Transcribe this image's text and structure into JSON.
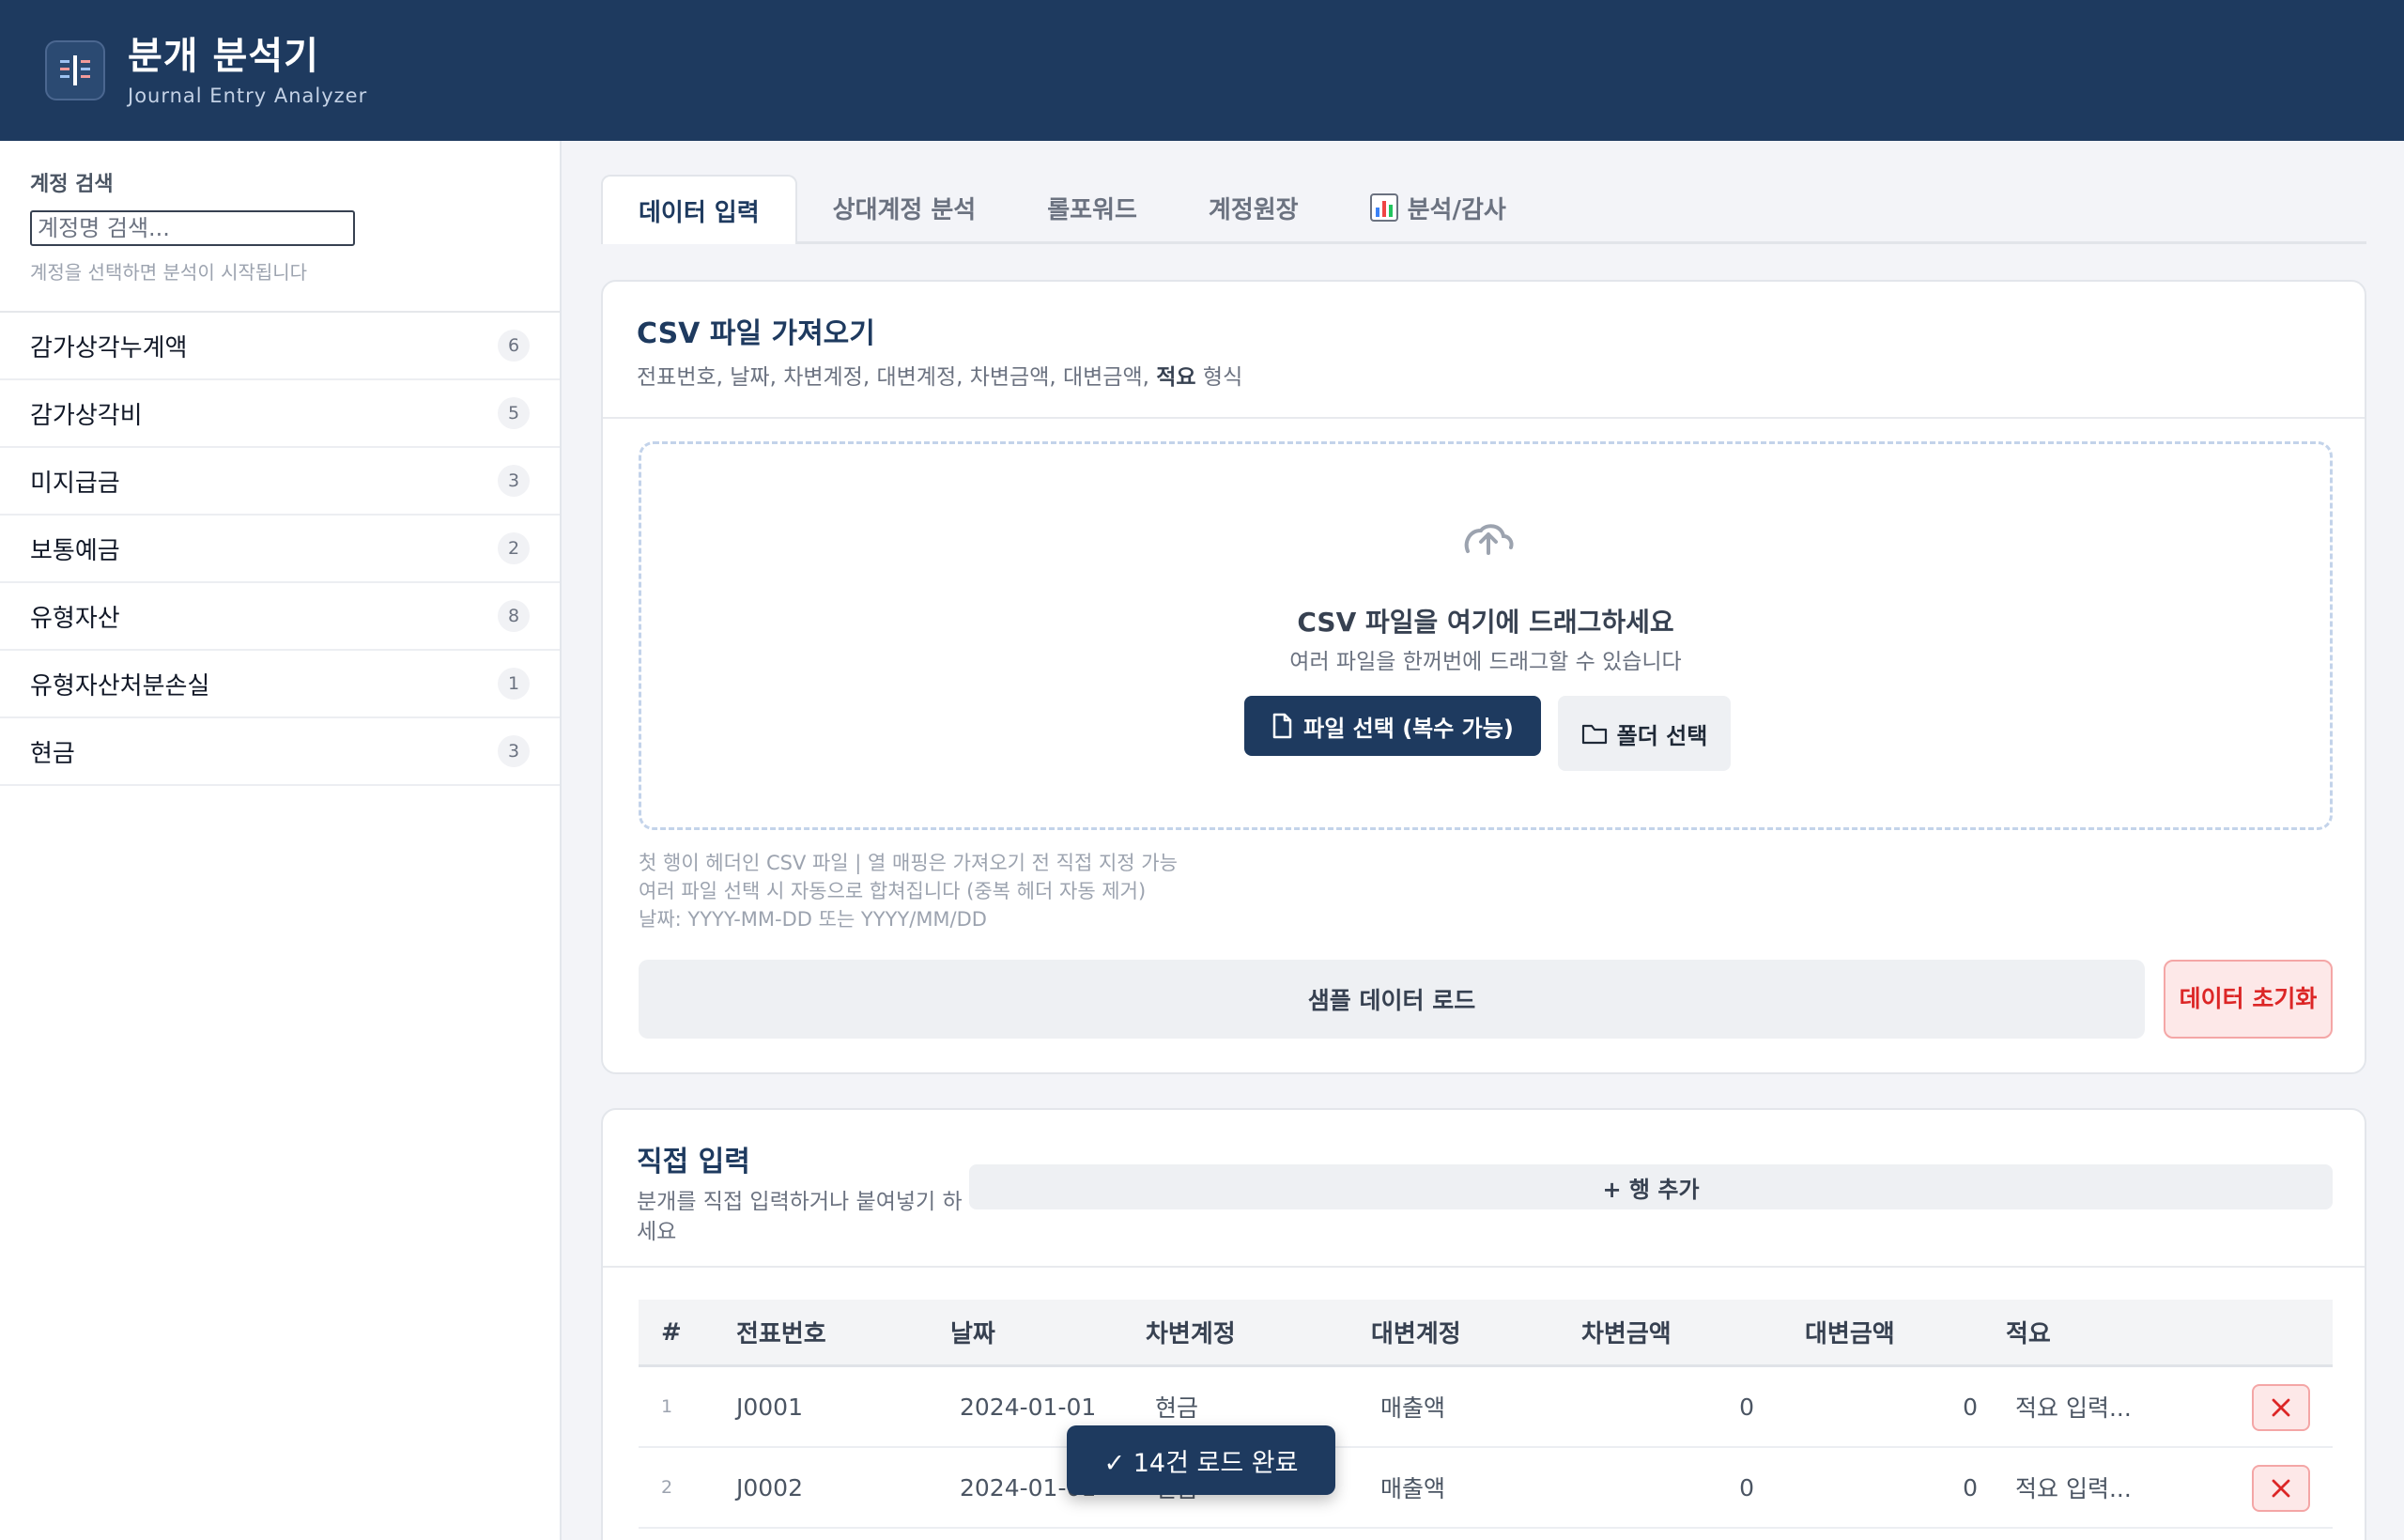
{
  "app": {
    "title": "분개 분석기",
    "subtitle": "Journal Entry Analyzer"
  },
  "sidebar": {
    "search_heading": "계정 검색",
    "search_placeholder": "계정명 검색...",
    "search_hint": "계정을 선택하면 분석이 시작됩니다",
    "accounts": [
      {
        "name": "감가상각누계액",
        "count": "6"
      },
      {
        "name": "감가상각비",
        "count": "5"
      },
      {
        "name": "미지급금",
        "count": "3"
      },
      {
        "name": "보통예금",
        "count": "2"
      },
      {
        "name": "유형자산",
        "count": "8"
      },
      {
        "name": "유형자산처분손실",
        "count": "1"
      },
      {
        "name": "현금",
        "count": "3"
      }
    ]
  },
  "tabs": [
    {
      "label": "데이터 입력"
    },
    {
      "label": "상대계정 분석"
    },
    {
      "label": "롤포워드"
    },
    {
      "label": "계정원장"
    },
    {
      "label": "분석/감사"
    }
  ],
  "csv_card": {
    "title": "CSV 파일 가져오기",
    "desc_prefix": "전표번호, 날짜, 차변계정, 대변계정, 차변금액, 대변금액, ",
    "desc_bold": "적요",
    "desc_suffix": " 형식",
    "drop_title": "CSV 파일을 여기에 드래그하세요",
    "drop_sub": "여러 파일을 한꺼번에 드래그할 수 있습니다",
    "file_button": "파일 선택 (복수 가능)",
    "folder_button": "폴더 선택",
    "notes": [
      "첫 행이 헤더인 CSV 파일 | 열 매핑은 가져오기 전 직접 지정 가능",
      "여러 파일 선택 시 자동으로 합쳐집니다 (중복 헤더 자동 제거)",
      "날짜: YYYY-MM-DD 또는 YYYY/MM/DD"
    ],
    "sample_button": "샘플 데이터 로드",
    "reset_button": "데이터 초기화"
  },
  "manual_card": {
    "title": "직접 입력",
    "desc": "분개를 직접 입력하거나 붙여넣기 하세요",
    "add_row_button": "+ 행 추가",
    "columns": [
      "#",
      "전표번호",
      "날짜",
      "차변계정",
      "대변계정",
      "차변금액",
      "대변금액",
      "적요"
    ],
    "rows": [
      {
        "no": "1",
        "voucher": "J0001",
        "date": "2024-01-01",
        "debit": "현금",
        "credit": "매출액",
        "debit_amt": "0",
        "credit_amt": "0",
        "memo_placeholder": "적요 입력..."
      },
      {
        "no": "2",
        "voucher": "J0002",
        "date": "2024-01-01",
        "debit": "현금",
        "credit": "매출액",
        "debit_amt": "0",
        "credit_amt": "0",
        "memo_placeholder": "적요 입력..."
      }
    ]
  },
  "toast": {
    "message": "✓ 14건 로드 완료"
  },
  "colors": {
    "primary": "#1e3a5f",
    "danger": "#dc2626",
    "danger_bg": "#fde8e8"
  }
}
